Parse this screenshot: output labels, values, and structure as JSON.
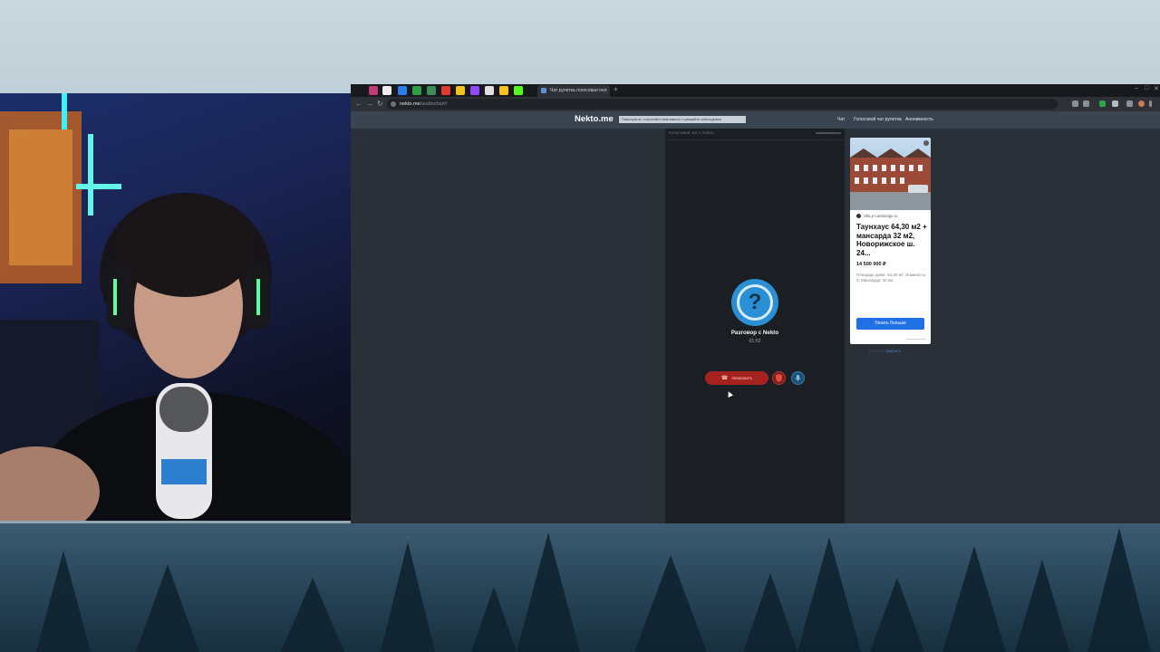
{
  "browser": {
    "active_tab_title": "Чат рулетка голосовая онл",
    "url_domain": "nekto.me",
    "url_path": "/audiochat#/",
    "new_tab_glyph": "+",
    "window_controls": [
      "–",
      "□",
      "✕"
    ],
    "nav_glyphs": [
      "←",
      "→",
      "↻"
    ],
    "tab_close_glyph": "×"
  },
  "site": {
    "logo": "Nekto.me",
    "notice": "Пожалуйста, сохраняйте вежливость и уважайте собеседника",
    "nav": [
      "Чат",
      "Голосовой чат рулетка",
      "Анонимность"
    ]
  },
  "chat": {
    "panel_title": "Голосовой чат с Nekto",
    "avatar_glyph": "?",
    "conversation_title": "Разговор с Nekto",
    "timer": "01:52",
    "end_button_label": "Завершить",
    "end_button_icon": "phone-hangup-icon",
    "report_icon": "shield-icon",
    "mic_icon": "microphone-icon"
  },
  "ad": {
    "source": "villa.p-cambridge.ru",
    "title": "Таунхаус 64,30 м2 + мансарда 32 м2, Новорижское ш. 24...",
    "price": "14 500 000 ₽",
    "description": "Площадь дома: 64,30 м²; Этажность: 3; Мансарда: 32 м2",
    "button": "Узнать больше",
    "menu_glyph": "⋮",
    "below_text": "Реклама",
    "below_link": "Закрыть"
  },
  "colors": {
    "accent_blue": "#2a8fd4",
    "end_red": "#a5231f",
    "ad_button": "#1f6fe5",
    "site_header": "#3a4350",
    "page_bg": "#2a3038"
  }
}
